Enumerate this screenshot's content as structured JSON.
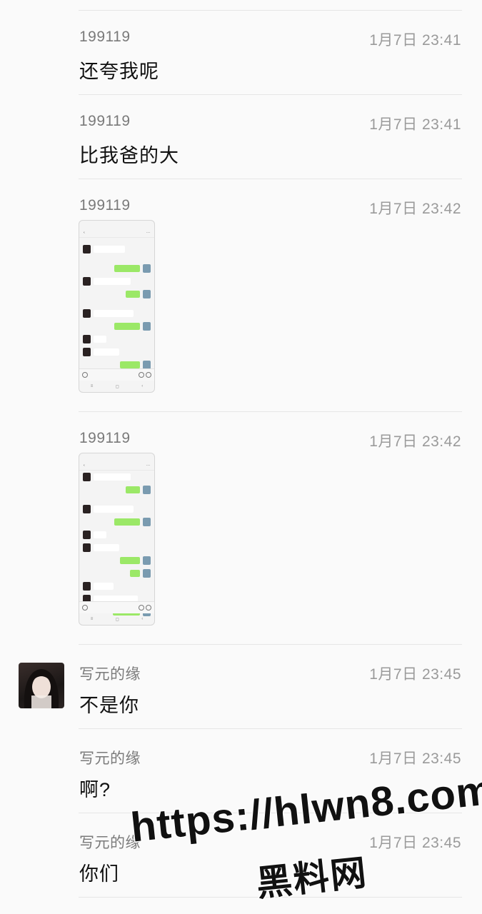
{
  "messages": [
    {
      "sender": "199119",
      "time": "1月7日 23:41",
      "text": "还夸我呢"
    },
    {
      "sender": "199119",
      "time": "1月7日 23:41",
      "text": "比我爸的大"
    },
    {
      "sender": "199119",
      "time": "1月7日 23:42",
      "image": "chat-screenshot"
    },
    {
      "sender": "199119",
      "time": "1月7日 23:42",
      "image": "chat-screenshot"
    },
    {
      "sender": "写元的缘",
      "time": "1月7日 23:45",
      "text": "不是你"
    },
    {
      "sender": "写元的缘",
      "time": "1月7日 23:45",
      "text": "啊?"
    },
    {
      "sender": "写元的缘",
      "time": "1月7日 23:45",
      "text": "你们"
    }
  ],
  "watermark": {
    "url": "https://hlwn8.com",
    "brand": "黑料网"
  },
  "colors": {
    "background": "#fafafa",
    "sender": "#7a7a7a",
    "time": "#9a9a9a",
    "bubble_green": "#9be867"
  }
}
